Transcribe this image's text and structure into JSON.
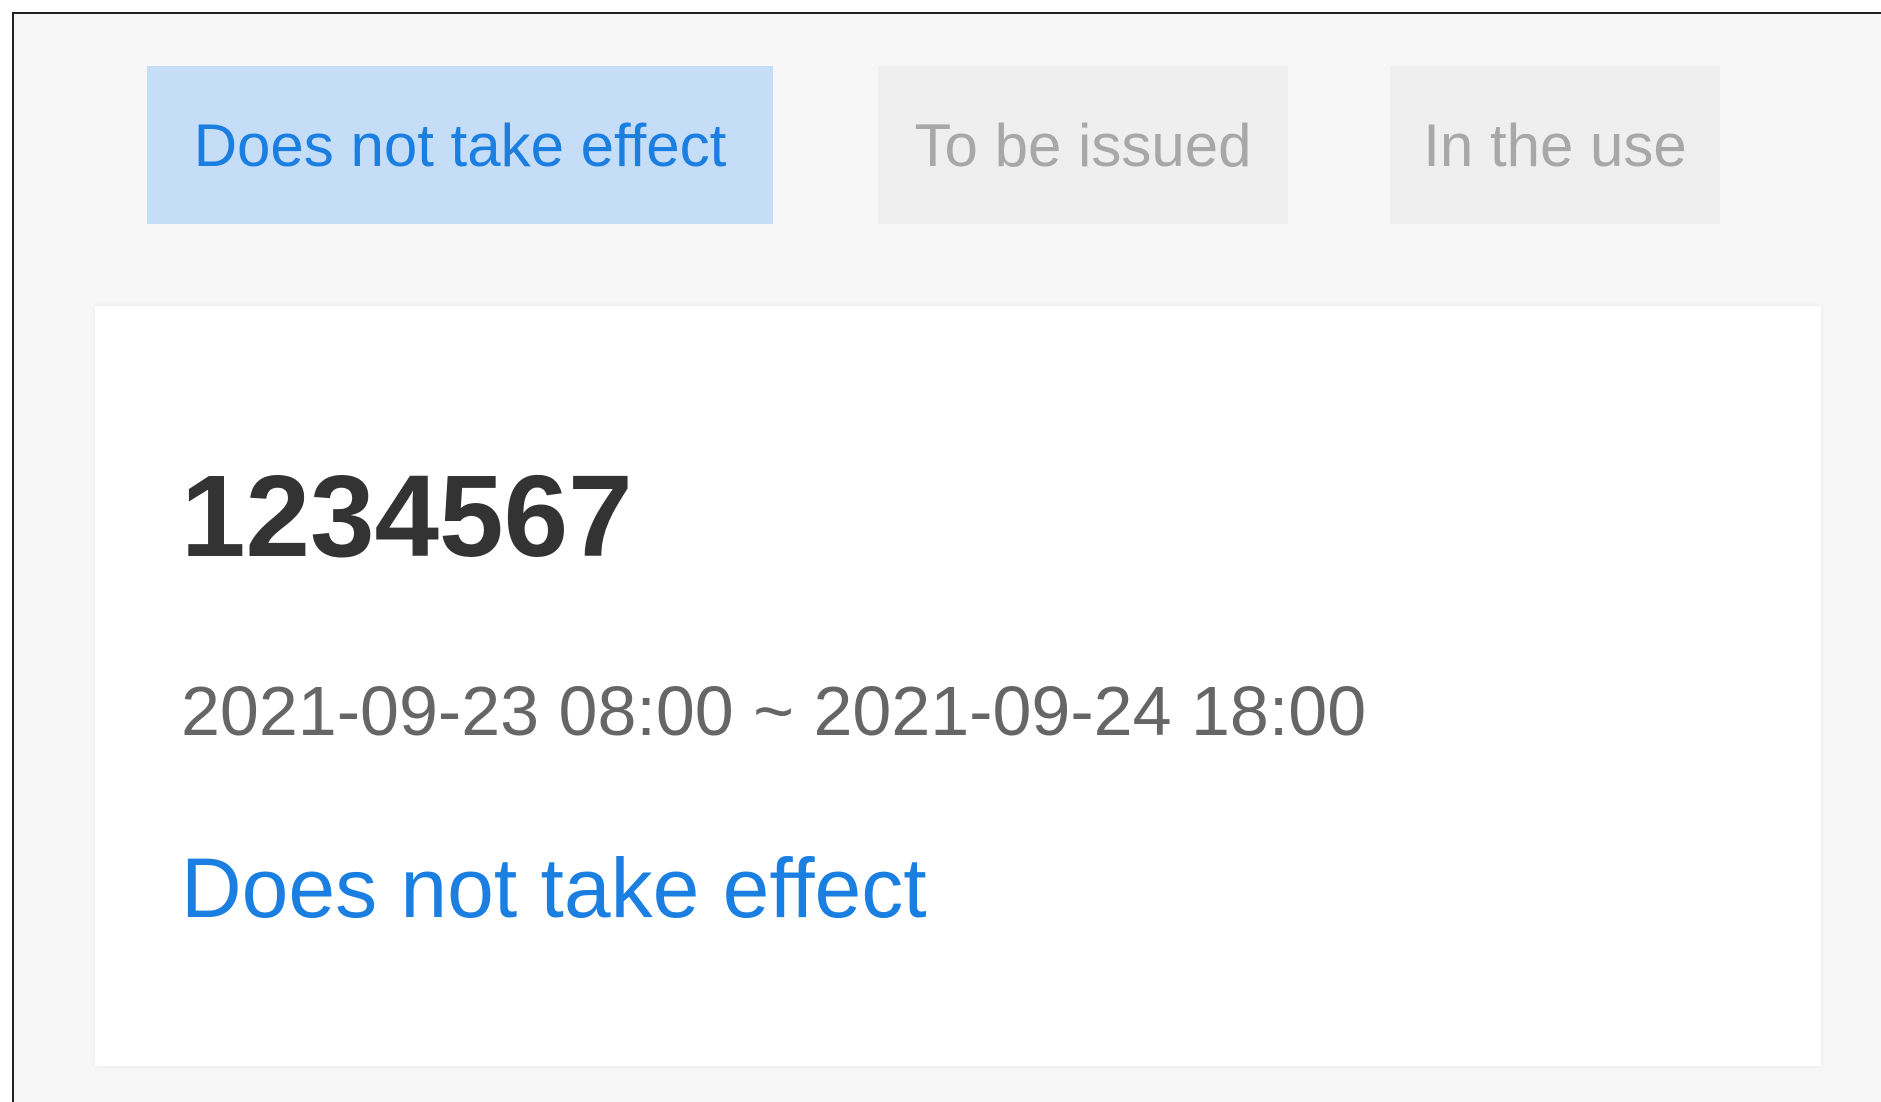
{
  "tabs": [
    {
      "label": "Does not take effect",
      "active": true
    },
    {
      "label": "To be issued",
      "active": false
    },
    {
      "label": "In the use",
      "active": false
    }
  ],
  "card": {
    "code": "1234567",
    "period": "2021-09-23 08:00 ~ 2021-09-24 18:00",
    "status": "Does not take effect"
  },
  "colors": {
    "accent": "#1a7fe0",
    "active_tab_bg": "#c6ddf7",
    "inactive_tab_bg": "#efefef",
    "inactive_tab_text": "#a8a8a8",
    "page_bg": "#f7f7f7",
    "card_bg": "#ffffff",
    "code_text": "#333333",
    "period_text": "#666666"
  }
}
